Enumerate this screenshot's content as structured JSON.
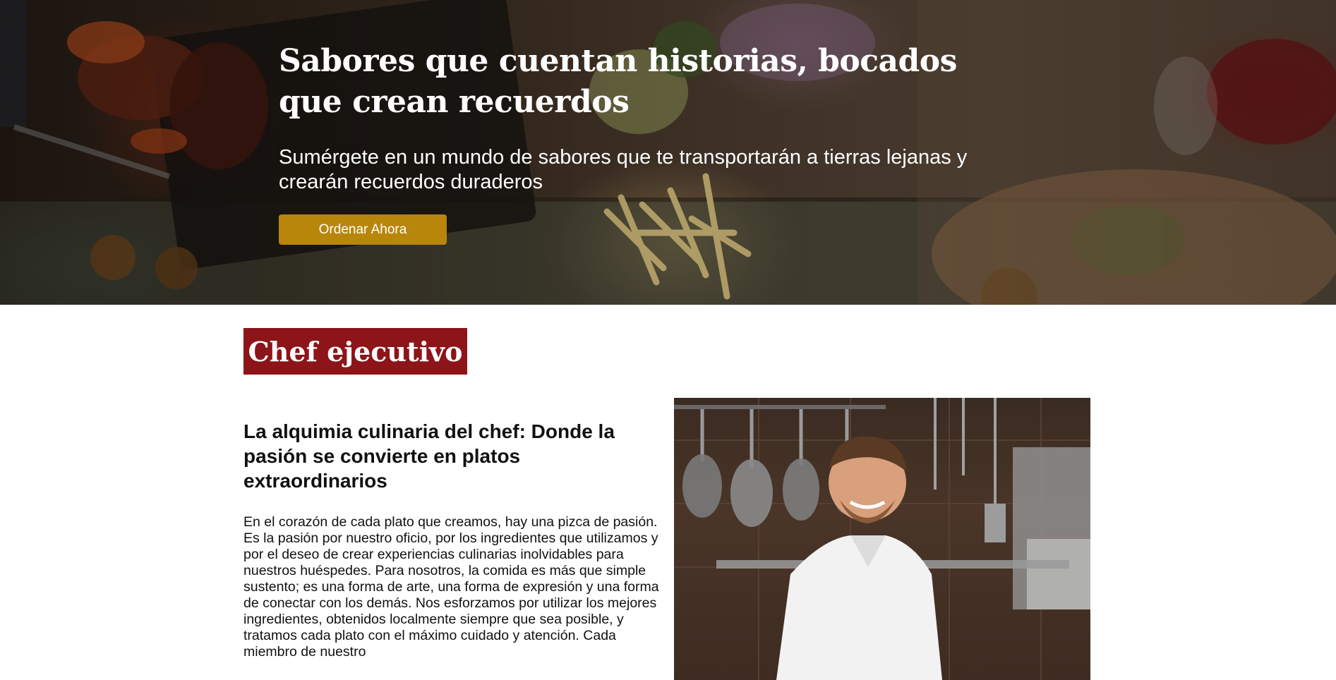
{
  "hero": {
    "title": "Sabores que cuentan historias, bocados que crean recuerdos",
    "subtitle": "Sumérgete en un mundo de sabores que te transportarán a tierras lejanas y crearán recuerdos duraderos",
    "cta_label": "Ordenar Ahora"
  },
  "chef_section": {
    "badge": "Chef ejecutivo",
    "heading": "La alquimia culinaria del chef: Donde la pasión se convierte en platos extraordinarios",
    "paragraph": "En el corazón de cada plato que creamos, hay una pizca de pasión. Es la pasión por nuestro oficio, por los ingredientes que utilizamos y por el deseo de crear experiencias culinarias inolvidables para nuestros huéspedes. Para nosotros, la comida es más que simple sustento; es una forma de arte, una forma de expresión y una forma de conectar con los demás. Nos esforzamos por utilizar los mejores ingredientes, obtenidos localmente siempre que sea posible, y tratamos cada plato con el máximo cuidado y atención. Cada miembro de nuestro"
  },
  "colors": {
    "cta_background": "#b8860b",
    "badge_background": "#8d1419"
  }
}
